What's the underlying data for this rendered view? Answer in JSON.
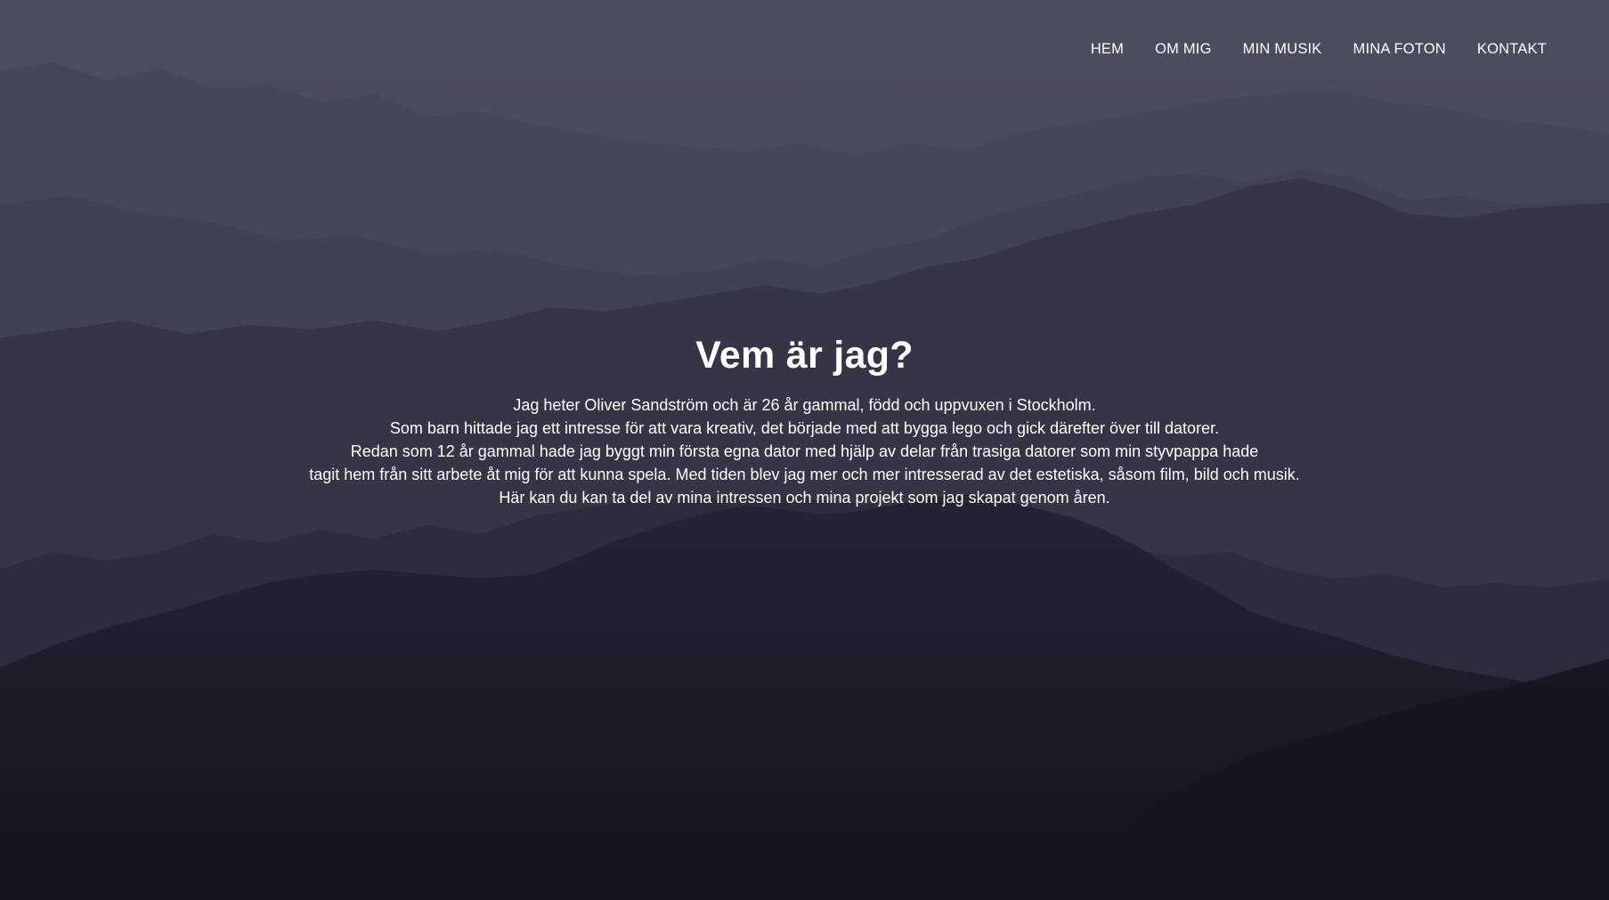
{
  "nav": {
    "items": [
      {
        "label": "HEM"
      },
      {
        "label": "OM MIG"
      },
      {
        "label": "MIN MUSIK"
      },
      {
        "label": "MINA FOTON"
      },
      {
        "label": "KONTAKT"
      }
    ]
  },
  "about": {
    "title": "Vem är jag?",
    "lines": [
      "Jag heter Oliver Sandström och är 26 år gammal, född och uppvuxen i Stockholm.",
      "Som barn hittade jag ett intresse för att vara kreativ, det började med att bygga lego och gick därefter över till datorer.",
      "Redan som 12 år gammal hade jag byggt min första egna dator med hjälp av delar från trasiga datorer som min styvpappa hade",
      "tagit hem från sitt arbete åt mig för att kunna spela. Med tiden blev jag mer och mer intresserad av det estetiska, såsom film, bild och musik.",
      "Här kan du kan ta del av mina intressen och mina projekt som jag skapat genom åren."
    ]
  },
  "colors": {
    "sky": "#4a4d5d",
    "ridge_far": "#434656",
    "ridge_mid": "#363848",
    "ridge_near": "#232533",
    "foreground": "#171923",
    "text": "#ffffff"
  }
}
